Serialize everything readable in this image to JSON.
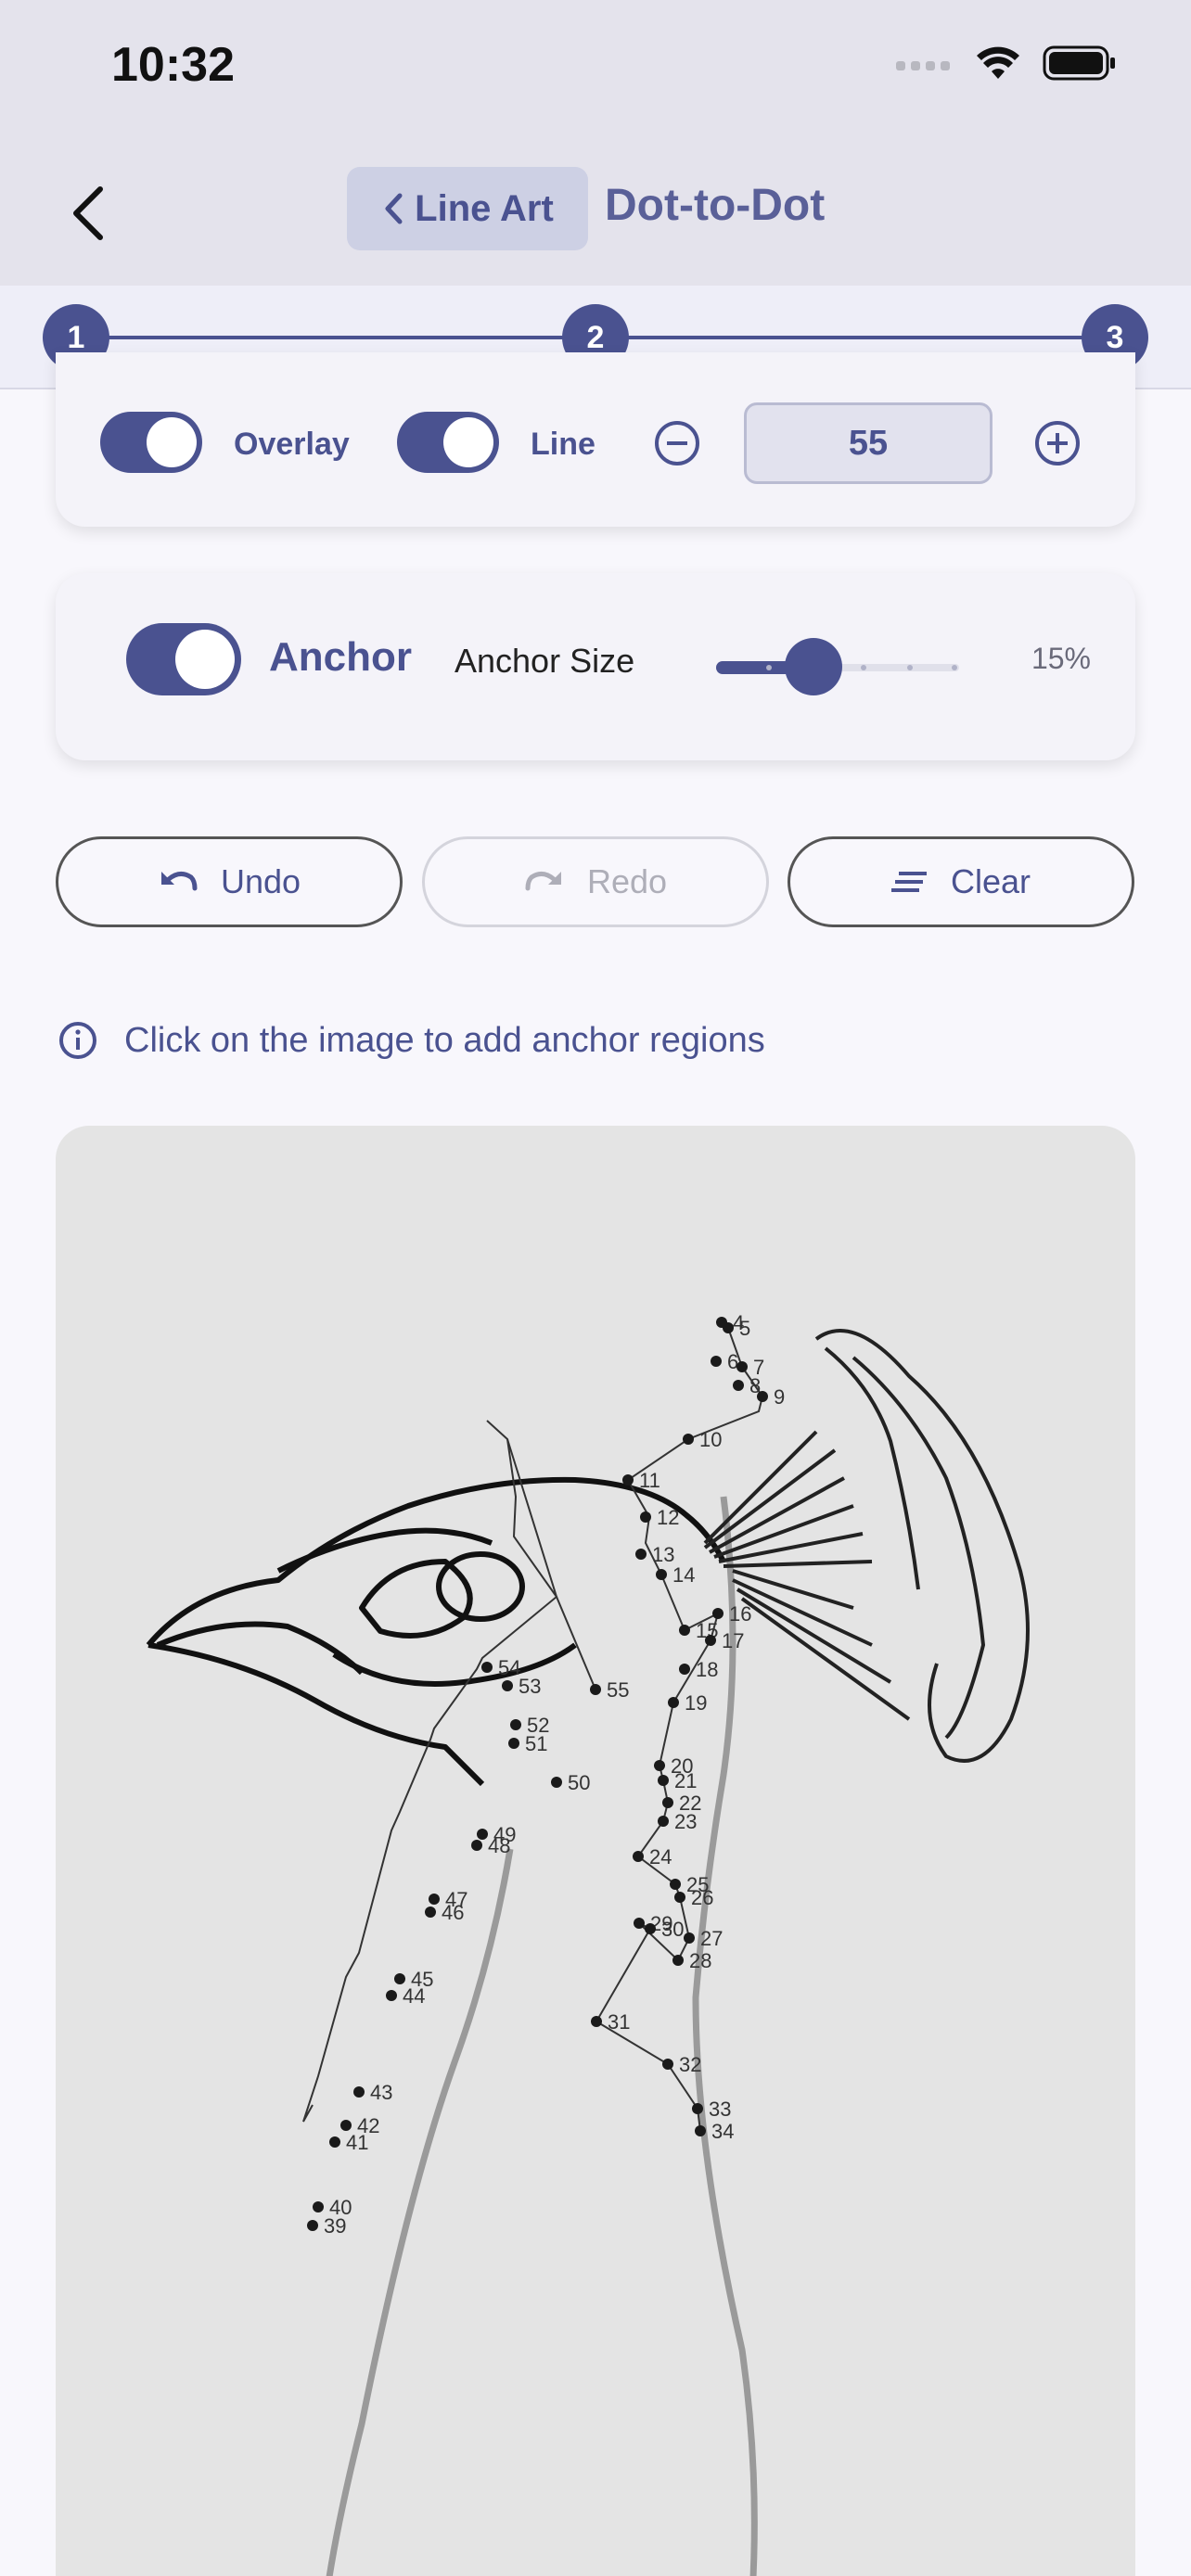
{
  "status": {
    "time": "10:32"
  },
  "nav": {
    "breadcrumb": "Line Art",
    "title": "Dot-to-Dot"
  },
  "stepper": {
    "steps": [
      "1",
      "2",
      "3"
    ]
  },
  "options": {
    "overlay_label": "Overlay",
    "line_label": "Line",
    "line_value": "55",
    "overlay_on": true,
    "line_on": true
  },
  "anchor": {
    "label": "Anchor",
    "size_label": "Anchor Size",
    "size_value": "15%",
    "enabled": true,
    "size_fraction": 0.15
  },
  "actions": {
    "undo": "Undo",
    "redo": "Redo",
    "clear": "Clear"
  },
  "info": {
    "message": "Click on the image to add anchor regions"
  },
  "dots": {
    "labels": [
      "4",
      "5",
      "6",
      "7",
      "8",
      "9",
      "10",
      "11",
      "12",
      "13",
      "14",
      "15",
      "16",
      "17",
      "18",
      "19",
      "20",
      "21",
      "22",
      "23",
      "24",
      "25",
      "26",
      "27",
      "28",
      "29",
      "30",
      "31",
      "32",
      "33",
      "34",
      "39",
      "40",
      "41",
      "42",
      "43",
      "44",
      "45",
      "46",
      "47",
      "48",
      "49",
      "50",
      "51",
      "52",
      "53",
      "54",
      "55"
    ]
  },
  "colors": {
    "accent": "#4a5290",
    "bar": "#e4e3ec",
    "background": "#f8f7fc"
  }
}
